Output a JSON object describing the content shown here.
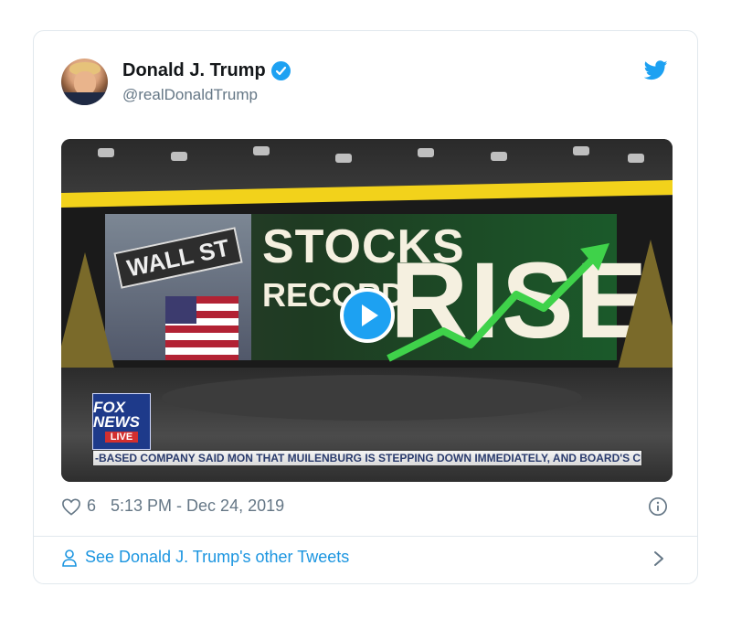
{
  "tweet": {
    "author_name": "Donald J. Trump",
    "handle": "@realDonaldTrump",
    "likes": "6",
    "timestamp": "5:13 PM - Dec 24, 2019",
    "see_more": "See Donald J. Trump's other Tweets"
  },
  "media": {
    "sign_text": "WALL ST",
    "headline_line1": "STOCKS",
    "headline_line2": "RECORD",
    "headline_big": "RISE",
    "network_logo": "FOX NEWS",
    "live_badge": "LIVE",
    "ticker": "-BASED COMPANY SAID MON THAT MUILENBURG IS STEPPING DOWN IMMEDIATELY, AND BOARD'S CURRI"
  },
  "icons": {
    "verified": "verified-badge-icon",
    "bird": "twitter-bird-icon",
    "play": "play-icon",
    "heart": "heart-icon",
    "info": "info-icon",
    "person": "person-icon",
    "chevron": "chevron-right-icon"
  },
  "colors": {
    "accent": "#1da1f2",
    "link": "#1b95e0",
    "muted": "#657786",
    "border": "#e1e8ed"
  }
}
